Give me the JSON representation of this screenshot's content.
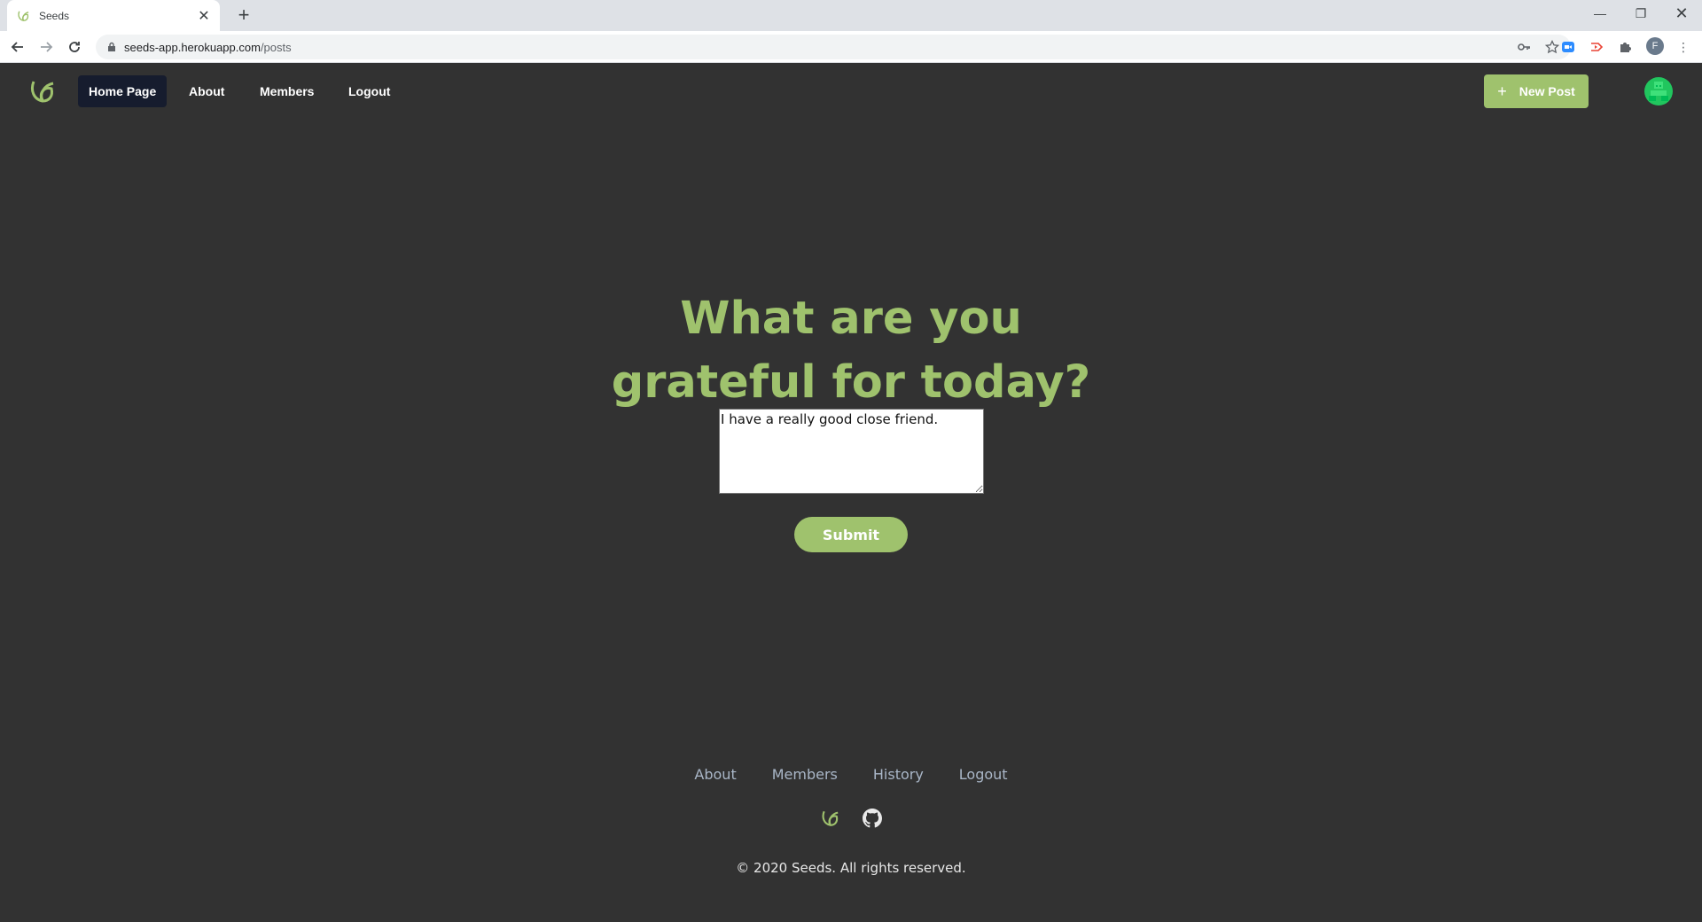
{
  "browser": {
    "tab_title": "Seeds",
    "url_host": "seeds-app.herokuapp.com",
    "url_path": "/posts",
    "profile_initial": "F",
    "icons": [
      "back-icon",
      "forward-icon",
      "reload-icon",
      "lock-icon",
      "key-icon",
      "star-icon",
      "zoom-extension-icon",
      "cast-extension-icon",
      "puzzle-extensions-icon",
      "kebab-menu-icon"
    ]
  },
  "nav": {
    "items": [
      {
        "label": "Home Page",
        "active": true
      },
      {
        "label": "About"
      },
      {
        "label": "Members"
      },
      {
        "label": "Logout"
      }
    ],
    "new_post_label": "New Post"
  },
  "main": {
    "heading_line1": "What are you",
    "heading_line2": "grateful for today?",
    "textarea_value": "I have a really good close friend.",
    "submit_label": "Submit"
  },
  "footer": {
    "links": [
      "About",
      "Members",
      "History",
      "Logout"
    ],
    "copyright": "© 2020 Seeds. All rights reserved."
  },
  "colors": {
    "accent": "#9fc26d",
    "background": "#323232",
    "active_nav": "#161c2e",
    "avatar": "#21c65e"
  }
}
